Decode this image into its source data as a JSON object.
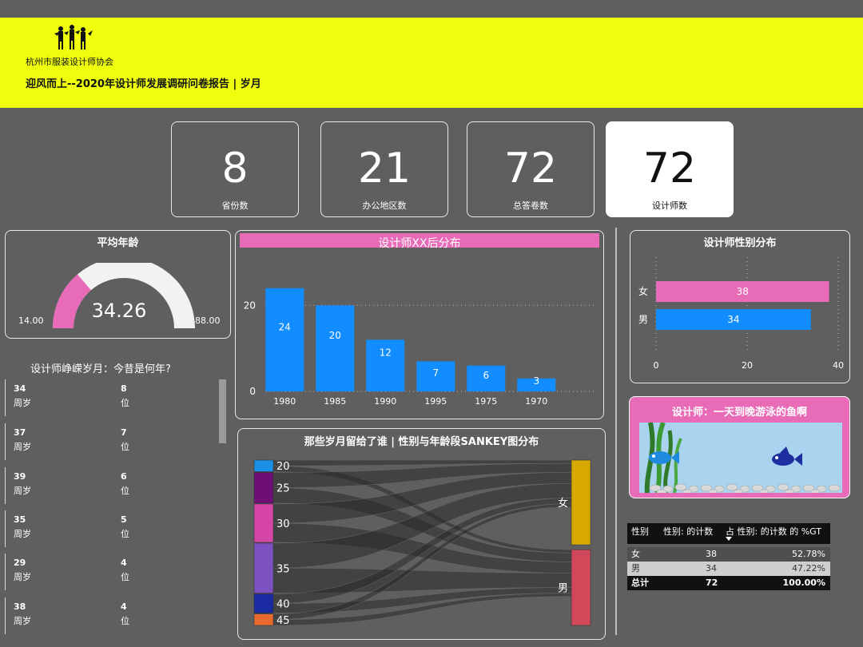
{
  "header": {
    "org_name": "杭州市服装设计师协会",
    "report_title": "迎风而上--2020年设计师发展调研问卷报告 | 岁月",
    "background": "#eefe0d"
  },
  "kpis": [
    {
      "value": "8",
      "label": "省份数"
    },
    {
      "value": "21",
      "label": "办公地区数"
    },
    {
      "value": "72",
      "label": "总答卷数"
    },
    {
      "value": "72",
      "label": "设计师数"
    }
  ],
  "gauge": {
    "title": "平均年龄",
    "min": "14.00",
    "max": "88.00",
    "value": "34.26",
    "value_num": 34.26,
    "min_num": 14,
    "max_num": 88,
    "fill_color": "#e86bb8",
    "track_color": "#f2f2f2"
  },
  "age_list": {
    "title": "设计师峥嵘岁月：今昔是何年?",
    "items": [
      {
        "age": "34",
        "age_unit": "周岁",
        "count": "8",
        "count_unit": "位"
      },
      {
        "age": "37",
        "age_unit": "周岁",
        "count": "7",
        "count_unit": "位"
      },
      {
        "age": "39",
        "age_unit": "周岁",
        "count": "6",
        "count_unit": "位"
      },
      {
        "age": "35",
        "age_unit": "周岁",
        "count": "5",
        "count_unit": "位"
      },
      {
        "age": "29",
        "age_unit": "周岁",
        "count": "4",
        "count_unit": "位"
      },
      {
        "age": "38",
        "age_unit": "周岁",
        "count": "4",
        "count_unit": "位"
      }
    ]
  },
  "decade_chart": {
    "title": "设计师XX后分布",
    "header_color": "#e86bb8"
  },
  "gender_chart": {
    "title": "设计师性别分布"
  },
  "sankey": {
    "title": "那些岁月留给了谁 | 性别与年龄段SANKEY图分布",
    "left_nodes": [
      {
        "label": "20",
        "color": "#1a8fe6",
        "count": 3
      },
      {
        "label": "25",
        "color": "#6d0f74",
        "count": 8
      },
      {
        "label": "30",
        "color": "#d546a8",
        "count": 10
      },
      {
        "label": "35",
        "color": "#7b52c0",
        "count": 13
      },
      {
        "label": "40",
        "color": "#1a2aa0",
        "count": 5
      },
      {
        "label": "45",
        "color": "#e86a30",
        "count": 3
      }
    ],
    "right_nodes": [
      {
        "label": "女",
        "color": "#d6a800",
        "count": 38
      },
      {
        "label": "男",
        "color": "#d0485a",
        "count": 34
      }
    ]
  },
  "fish": {
    "title": "设计师：一天到晚游泳的鱼啊"
  },
  "table": {
    "headers": [
      "性别",
      "性别: 的计数",
      "占 性别: 的计数 的 %GT"
    ],
    "rows": [
      {
        "gender": "女",
        "count": "38",
        "pct": "52.78%"
      },
      {
        "gender": "男",
        "count": "34",
        "pct": "47.22%"
      }
    ],
    "total": {
      "label": "总计",
      "count": "72",
      "pct": "100.00%"
    }
  },
  "chart_data": [
    {
      "type": "bar",
      "title": "设计师XX后分布",
      "categories": [
        "1980",
        "1985",
        "1990",
        "1995",
        "1975",
        "1970"
      ],
      "values": [
        24,
        20,
        12,
        7,
        6,
        3
      ],
      "ylim": [
        0,
        26
      ],
      "yticks": [
        "0",
        "20"
      ],
      "color": "#118dff",
      "grid": true
    },
    {
      "type": "bar",
      "orientation": "horizontal",
      "title": "设计师性别分布",
      "categories": [
        "女",
        "男"
      ],
      "values": [
        38,
        34
      ],
      "colors": [
        "#e86bb8",
        "#118dff"
      ],
      "xlim": [
        0,
        40
      ],
      "xticks": [
        "0",
        "20",
        "40"
      ],
      "grid": true
    }
  ]
}
